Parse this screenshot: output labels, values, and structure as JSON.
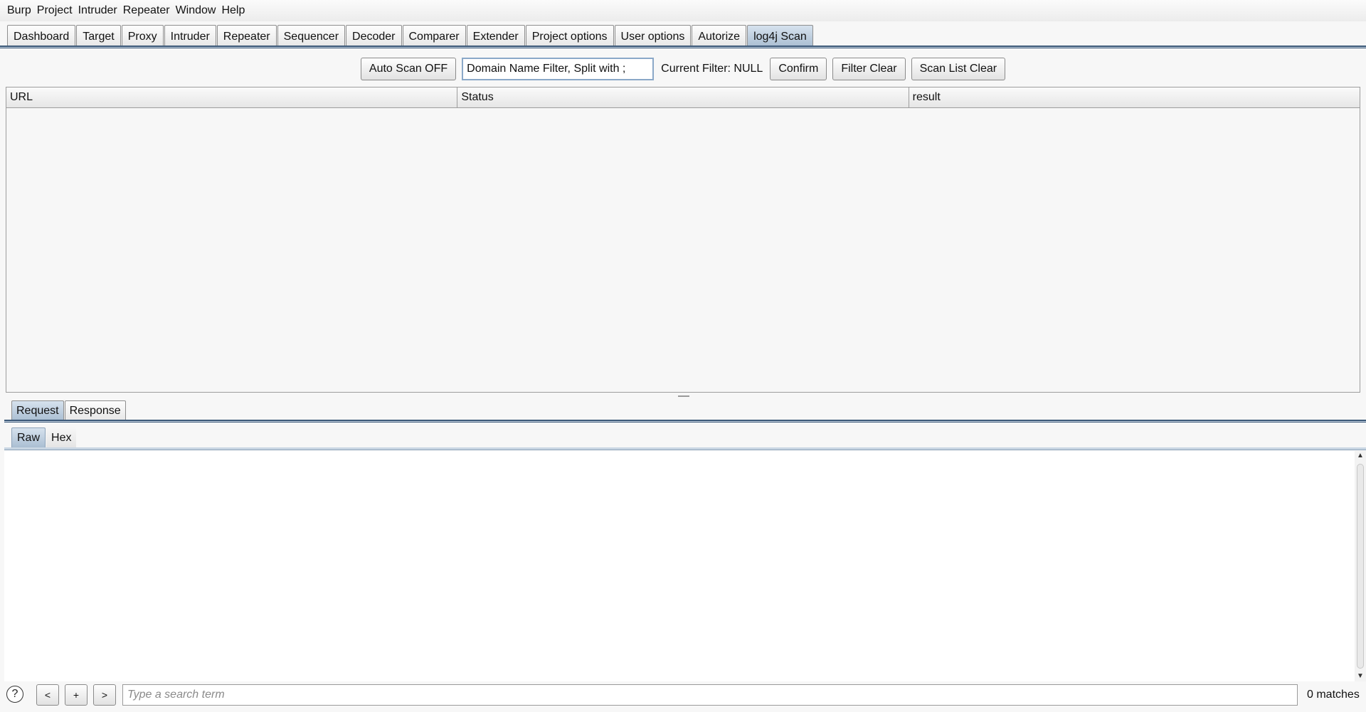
{
  "menu": [
    "Burp",
    "Project",
    "Intruder",
    "Repeater",
    "Window",
    "Help"
  ],
  "tabs": [
    "Dashboard",
    "Target",
    "Proxy",
    "Intruder",
    "Repeater",
    "Sequencer",
    "Decoder",
    "Comparer",
    "Extender",
    "Project options",
    "User options",
    "Autorize",
    "log4j Scan"
  ],
  "active_tab": "log4j Scan",
  "toolbar": {
    "auto_scan_label": "Auto Scan OFF",
    "filter_input_value": "Domain Name Filter, Split with ;",
    "current_filter_label": "Current Filter: NULL",
    "confirm_label": "Confirm",
    "filter_clear_label": "Filter Clear",
    "scan_list_clear_label": "Scan List Clear"
  },
  "table": {
    "columns": [
      "URL",
      "Status",
      "result"
    ],
    "rows": []
  },
  "message_tabs": [
    "Request",
    "Response"
  ],
  "active_message_tab": "Request",
  "view_tabs": [
    "Raw",
    "Hex"
  ],
  "active_view_tab": "Raw",
  "search": {
    "help_label": "?",
    "prev_label": "<",
    "add_label": "+",
    "next_label": ">",
    "placeholder": "Type a search term",
    "matches": "0 matches"
  },
  "colors": {
    "active_tab": "#a9bdd1",
    "tab_underline": "#3b5878"
  }
}
